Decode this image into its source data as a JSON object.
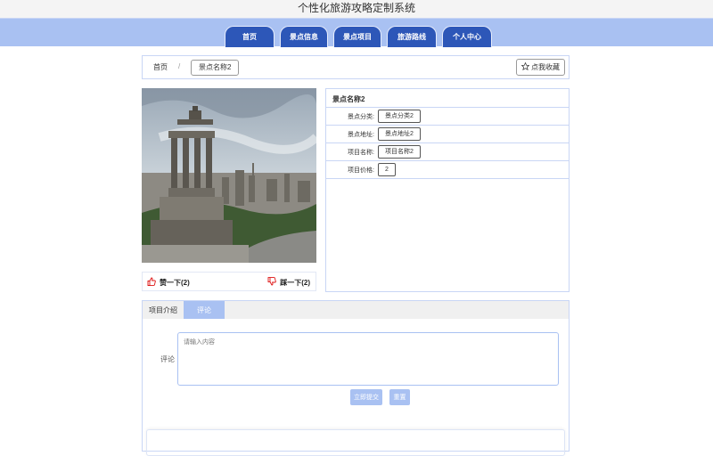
{
  "header": {
    "title": "个性化旅游攻略定制系统"
  },
  "nav": {
    "items": [
      "首页",
      "景点信息",
      "景点项目",
      "旅游路线",
      "个人中心"
    ]
  },
  "breadcrumb": {
    "home": "首页",
    "separator": "/",
    "current": "景点名称2",
    "favorite_label": "点我收藏"
  },
  "detail": {
    "name": "景点名称2",
    "rows": [
      {
        "label": "景点分类:",
        "value": "景点分类2"
      },
      {
        "label": "景点地址:",
        "value": "景点地址2"
      },
      {
        "label": "项目名称:",
        "value": "项目名称2"
      },
      {
        "label": "项目价格:",
        "value": "2"
      }
    ]
  },
  "reactions": {
    "like_label": "赞一下(2)",
    "dislike_label": "踩一下(2)"
  },
  "tabs": {
    "items": [
      "项目介绍",
      "评论"
    ],
    "active": "评论"
  },
  "comment": {
    "label": "评论",
    "placeholder": "请输入内容",
    "submit_label": "立即提交",
    "reset_label": "重置"
  },
  "colors": {
    "nav_bg": "#a9c1f2",
    "nav_item": "#2d57b8",
    "accent": "#a9c1f2",
    "border": "#c9d6f5"
  },
  "icons": {
    "favorite": "star-icon",
    "like": "thumbs-up-icon",
    "dislike": "thumbs-down-icon"
  }
}
